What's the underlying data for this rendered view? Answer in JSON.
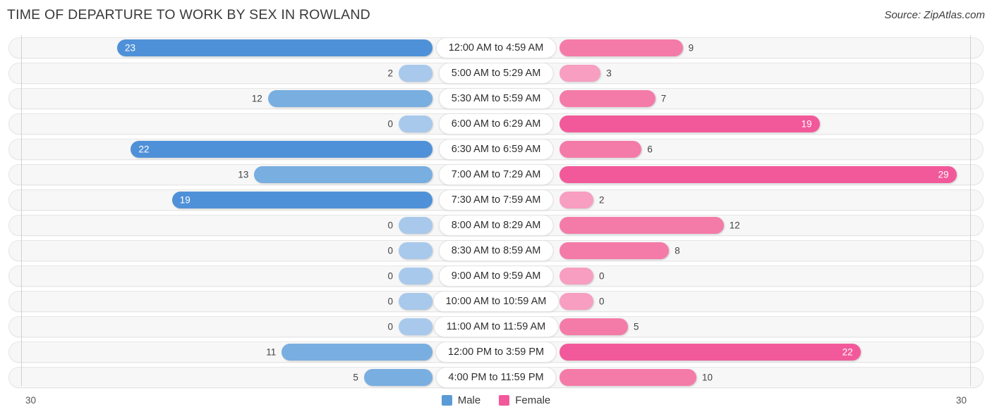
{
  "header": {
    "title": "TIME OF DEPARTURE TO WORK BY SEX IN ROWLAND",
    "source": "Source: ZipAtlas.com"
  },
  "axis": {
    "left_max": "30",
    "right_max": "30"
  },
  "legend": {
    "items": [
      {
        "label": "Male",
        "color": "#5b9bd5",
        "icon": "legend-swatch-male"
      },
      {
        "label": "Female",
        "color": "#f2599a",
        "icon": "legend-swatch-female"
      }
    ]
  },
  "colors": {
    "male_strong": "#4f91d8",
    "male_mid": "#79aee0",
    "male_light": "#a8c9ec",
    "female_strong": "#f2599a",
    "female_mid": "#f47ba8",
    "female_light": "#f79ec1",
    "track": "#f7f7f7",
    "track_border": "#e6e6e6",
    "axis_line": "#d0d0d0"
  },
  "chart_data": {
    "type": "bar",
    "title": "TIME OF DEPARTURE TO WORK BY SEX IN ROWLAND",
    "subtitle": "",
    "xlabel": "",
    "ylabel": "",
    "orientation": "horizontal-diverging",
    "grid": false,
    "legend_position": "bottom-center",
    "xlim": [
      30,
      30
    ],
    "axis_max_left": 30,
    "axis_max_right": 30,
    "categories": [
      "12:00 AM to 4:59 AM",
      "5:00 AM to 5:29 AM",
      "5:30 AM to 5:59 AM",
      "6:00 AM to 6:29 AM",
      "6:30 AM to 6:59 AM",
      "7:00 AM to 7:29 AM",
      "7:30 AM to 7:59 AM",
      "8:00 AM to 8:29 AM",
      "8:30 AM to 8:59 AM",
      "9:00 AM to 9:59 AM",
      "10:00 AM to 10:59 AM",
      "11:00 AM to 11:59 AM",
      "12:00 PM to 3:59 PM",
      "4:00 PM to 11:59 PM"
    ],
    "series": [
      {
        "name": "Male",
        "color": "#5b9bd5",
        "values": [
          23,
          2,
          12,
          0,
          22,
          13,
          19,
          0,
          0,
          0,
          0,
          0,
          11,
          5
        ]
      },
      {
        "name": "Female",
        "color": "#f2599a",
        "values": [
          9,
          3,
          7,
          19,
          6,
          29,
          2,
          12,
          8,
          0,
          0,
          5,
          22,
          10
        ]
      }
    ]
  },
  "rows": [
    {
      "category": "12:00 AM to 4:59 AM",
      "male": "23",
      "female": "9",
      "male_inside": true,
      "female_inside": false
    },
    {
      "category": "5:00 AM to 5:29 AM",
      "male": "2",
      "female": "3",
      "male_inside": false,
      "female_inside": false
    },
    {
      "category": "5:30 AM to 5:59 AM",
      "male": "12",
      "female": "7",
      "male_inside": false,
      "female_inside": false
    },
    {
      "category": "6:00 AM to 6:29 AM",
      "male": "0",
      "female": "19",
      "male_inside": false,
      "female_inside": true
    },
    {
      "category": "6:30 AM to 6:59 AM",
      "male": "22",
      "female": "6",
      "male_inside": true,
      "female_inside": false
    },
    {
      "category": "7:00 AM to 7:29 AM",
      "male": "13",
      "female": "29",
      "male_inside": false,
      "female_inside": true
    },
    {
      "category": "7:30 AM to 7:59 AM",
      "male": "19",
      "female": "2",
      "male_inside": true,
      "female_inside": false
    },
    {
      "category": "8:00 AM to 8:29 AM",
      "male": "0",
      "female": "12",
      "male_inside": false,
      "female_inside": false
    },
    {
      "category": "8:30 AM to 8:59 AM",
      "male": "0",
      "female": "8",
      "male_inside": false,
      "female_inside": false
    },
    {
      "category": "9:00 AM to 9:59 AM",
      "male": "0",
      "female": "0",
      "male_inside": false,
      "female_inside": false
    },
    {
      "category": "10:00 AM to 10:59 AM",
      "male": "0",
      "female": "0",
      "male_inside": false,
      "female_inside": false
    },
    {
      "category": "11:00 AM to 11:59 AM",
      "male": "0",
      "female": "5",
      "male_inside": false,
      "female_inside": false
    },
    {
      "category": "12:00 PM to 3:59 PM",
      "male": "11",
      "female": "22",
      "male_inside": false,
      "female_inside": true
    },
    {
      "category": "4:00 PM to 11:59 PM",
      "male": "5",
      "female": "10",
      "male_inside": false,
      "female_inside": false
    }
  ]
}
